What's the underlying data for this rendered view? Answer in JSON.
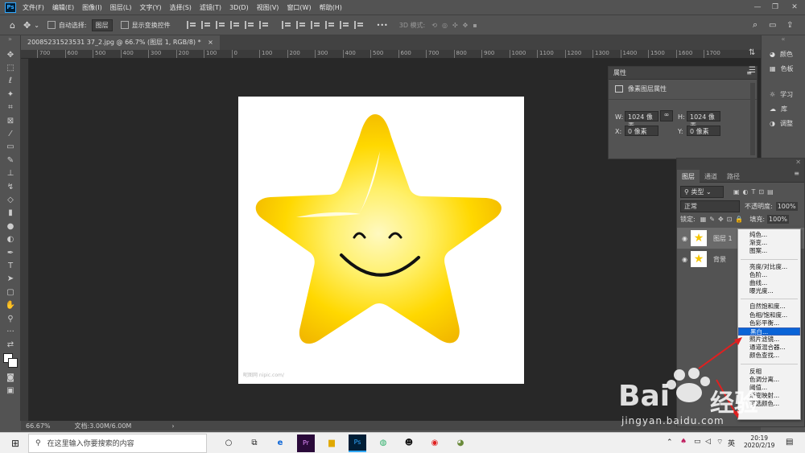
{
  "menubar": {
    "logo": "Ps",
    "items": [
      "文件(F)",
      "编辑(E)",
      "图像(I)",
      "图层(L)",
      "文字(Y)",
      "选择(S)",
      "滤镜(T)",
      "3D(D)",
      "视图(V)",
      "窗口(W)",
      "帮助(H)"
    ]
  },
  "options": {
    "auto_select": "自动选择:",
    "auto_select_value": "图层",
    "show_transform": "显示变换控件",
    "mode_3d": "3D 模式:"
  },
  "document": {
    "tab_title": "20085231523531 37_2.jpg @ 66.7% (图层 1, RGB/8) *",
    "close": "×"
  },
  "ruler": {
    "ticks": [
      "700",
      "600",
      "500",
      "400",
      "300",
      "200",
      "100",
      "0",
      "100",
      "200",
      "300",
      "400",
      "500",
      "600",
      "700",
      "800",
      "900",
      "1000",
      "1100",
      "1200",
      "1300",
      "1400",
      "1500",
      "1600",
      "1700"
    ]
  },
  "status": {
    "zoom": "66.67%",
    "doc_size": "文档:3.00M/6.00M",
    "arrow": "›"
  },
  "canvas": {
    "watermark": "昵图网 nipic.com/"
  },
  "properties": {
    "title": "属性",
    "subtitle": "像素图层属性",
    "w_label": "W:",
    "w_value": "1024 像素",
    "h_label": "H:",
    "h_value": "1024 像素",
    "x_label": "X:",
    "x_value": "0 像素",
    "y_label": "Y:",
    "y_value": "0 像素"
  },
  "layers": {
    "tabs": [
      "图层",
      "通道",
      "路径"
    ],
    "filter": "类型",
    "blend_mode": "正常",
    "opacity_label": "不透明度:",
    "opacity_value": "100%",
    "lock_label": "锁定:",
    "fill_label": "填充:",
    "fill_value": "100%",
    "rows": [
      {
        "name": "图层 1"
      },
      {
        "name": "背景"
      }
    ]
  },
  "context_menu": {
    "group1": [
      "纯色...",
      "渐变...",
      "图案..."
    ],
    "group2": [
      "亮度/对比度...",
      "色阶...",
      "曲线...",
      "曝光度..."
    ],
    "group3": [
      "自然饱和度...",
      "色相/饱和度...",
      "色彩平衡...",
      "黑白...",
      "照片滤镜...",
      "通道混合器...",
      "颜色查找..."
    ],
    "group4": [
      "反相",
      "色调分离...",
      "阈值...",
      "渐变映射...",
      "可选颜色..."
    ],
    "highlighted": "黑白..."
  },
  "right_dock": {
    "items": [
      "颜色",
      "色板",
      "学习",
      "库",
      "调整"
    ]
  },
  "taskbar": {
    "search_placeholder": "在这里输入你要搜索的内容",
    "time": "20:19",
    "date": "2020/2/19",
    "ime": "英"
  },
  "watermark": {
    "brand": "Bai",
    "brand2": "经验",
    "url": "jingyan.baidu.com"
  },
  "colors": {
    "accent": "#0a64d7",
    "star_yellow": "#ffd400",
    "ps_blue": "#31a8ff"
  }
}
